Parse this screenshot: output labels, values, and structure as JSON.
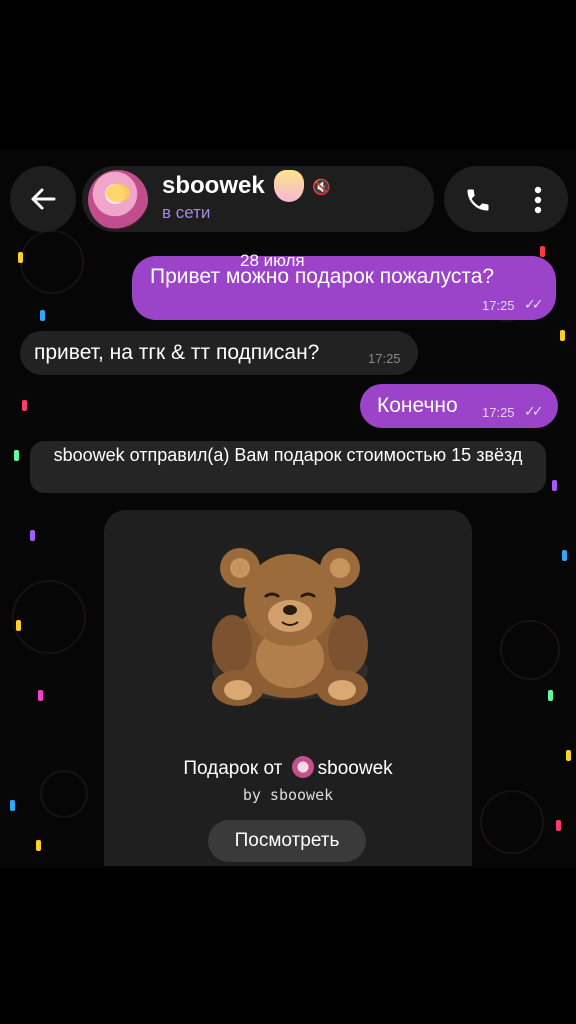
{
  "header": {
    "contact_name": "sboowek",
    "status": "в сети",
    "back_icon": "arrow-left-icon",
    "call_icon": "phone-icon",
    "menu_icon": "more-vertical-icon",
    "accent_color": "#a58bd9"
  },
  "chat": {
    "date": "28 июля",
    "messages": [
      {
        "text": "Привет можно подарок пожалуста?",
        "time": "17:25",
        "direction": "outgoing"
      },
      {
        "text": "привет, на тгк & тт подписан?",
        "time": "17:25",
        "direction": "incoming"
      },
      {
        "text": "Конечно",
        "time": "17:25",
        "direction": "outgoing"
      }
    ],
    "service_message": "sboowek отправил(а) Вам подарок стоимостью 15 звёзд",
    "gift": {
      "title_prefix": "Подарок от",
      "title_name": "sboowek",
      "by_line": "by sboowek",
      "view_button": "Посмотреть"
    },
    "bubble_color": "#9b43c9"
  }
}
